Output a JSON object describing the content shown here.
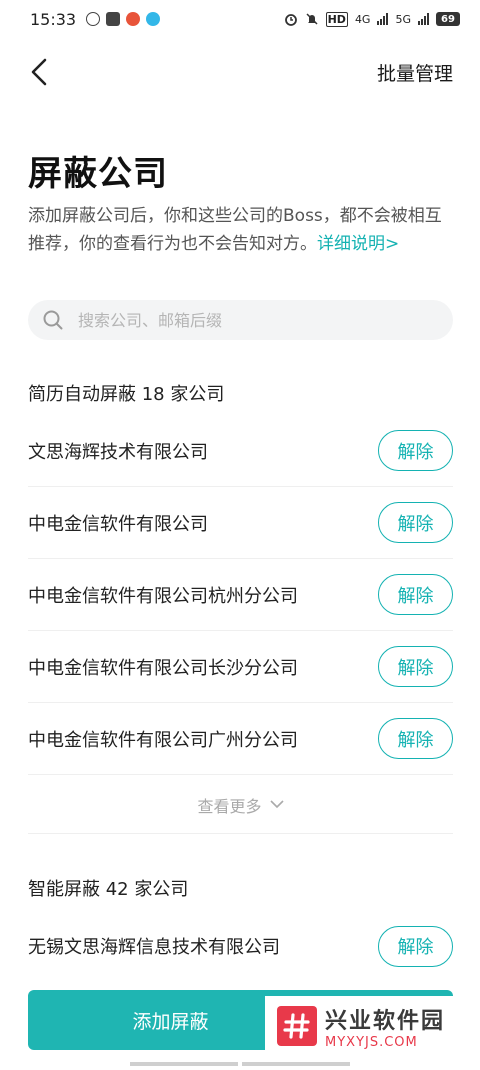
{
  "status_bar": {
    "time": "15:33",
    "network_hd": "HD",
    "network_4g": "4G",
    "network_5g": "5G",
    "battery": "69"
  },
  "header": {
    "batch_manage": "批量管理"
  },
  "page": {
    "title": "屏蔽公司",
    "description": "添加屏蔽公司后，你和这些公司的Boss，都不会被相互推荐，你的查看行为也不会告知对方。",
    "detail_link": "详细说明>"
  },
  "search": {
    "placeholder": "搜索公司、邮箱后缀"
  },
  "auto_section": {
    "title": "简历自动屏蔽 18 家公司",
    "items": [
      {
        "name": "文思海辉技术有限公司",
        "action": "解除"
      },
      {
        "name": "中电金信软件有限公司",
        "action": "解除"
      },
      {
        "name": "中电金信软件有限公司杭州分公司",
        "action": "解除"
      },
      {
        "name": "中电金信软件有限公司长沙分公司",
        "action": "解除"
      },
      {
        "name": "中电金信软件有限公司广州分公司",
        "action": "解除"
      }
    ],
    "more": "查看更多"
  },
  "smart_section": {
    "title": "智能屏蔽 42 家公司",
    "items": [
      {
        "name": "无锡文思海辉信息技术有限公司",
        "action": "解除"
      }
    ]
  },
  "add_button": "添加屏蔽",
  "watermark": {
    "cn": "兴业软件园",
    "en": "MYXYJS.COM"
  },
  "colors": {
    "accent": "#14b2b2",
    "button": "#1fb5b2"
  }
}
